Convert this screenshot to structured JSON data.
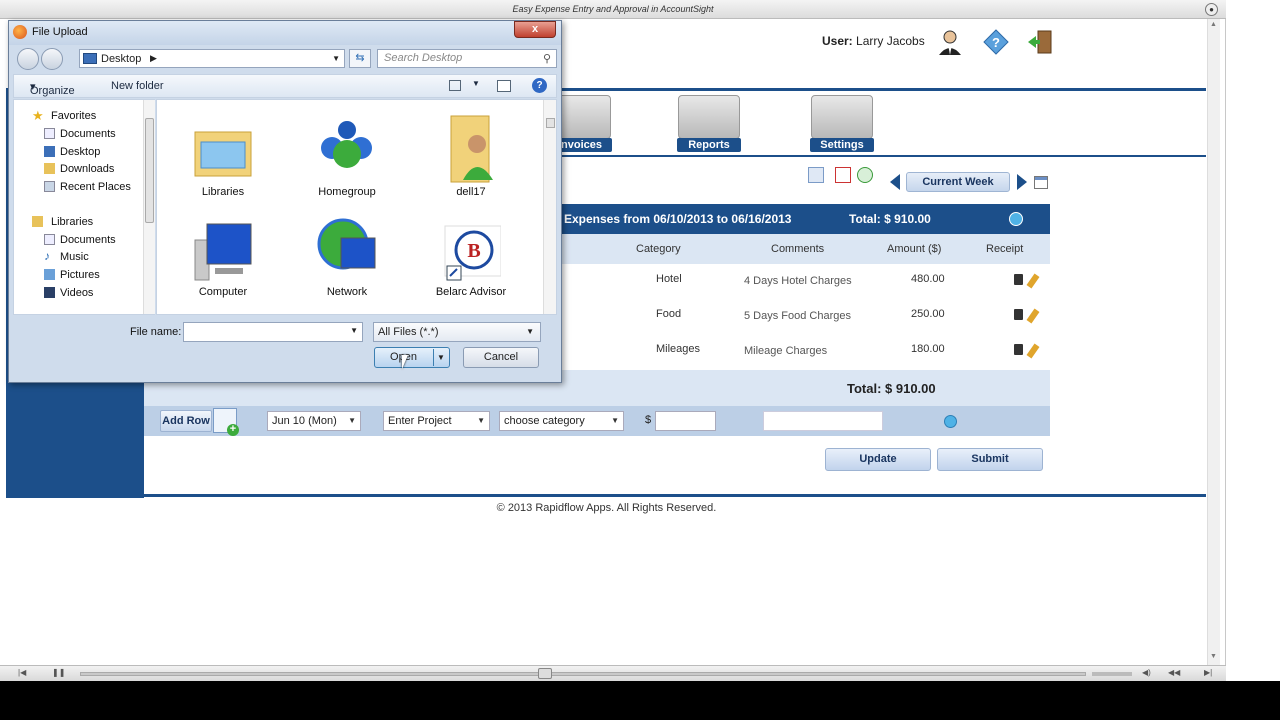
{
  "window": {
    "title": "Easy Expense Entry and Approval in AccountSight"
  },
  "header": {
    "user_label": "User:",
    "user_name": "Larry Jacobs"
  },
  "nav": {
    "tabs": [
      {
        "label": "Invoices"
      },
      {
        "label": "Reports"
      },
      {
        "label": "Settings"
      }
    ]
  },
  "week": {
    "current_label": "Current Week"
  },
  "expenses": {
    "range_text": "Expenses from  06/10/2013 to 06/16/2013",
    "total_header": "Total: $ 910.00",
    "columns": [
      "Category",
      "Comments",
      "Amount ($)",
      "Receipt"
    ],
    "rows": [
      {
        "category": "Hotel",
        "comment": "4 Days Hotel Charges",
        "amount": "480.00"
      },
      {
        "category": "Food",
        "comment": "5 Days Food Charges",
        "amount": "250.00"
      },
      {
        "category": "Mileages",
        "comment": "Mileage Charges",
        "amount": "180.00"
      }
    ],
    "total_footer": "Total: $ 910.00"
  },
  "add_row": {
    "button_label": "Add Row",
    "date": "Jun 10 (Mon)",
    "project": "Enter Project",
    "category": "choose category",
    "currency": "$"
  },
  "actions": {
    "update": "Update",
    "submit": "Submit"
  },
  "footer": {
    "copyright": "© 2013 Rapidflow Apps. All Rights Reserved."
  },
  "dialog": {
    "title": "File Upload",
    "close": "x",
    "address": "Desktop",
    "search_placeholder": "Search Desktop",
    "toolbar": {
      "organize": "Organize",
      "new_folder": "New folder"
    },
    "nav_groups": [
      {
        "label": "Favorites",
        "items": [
          "Documents",
          "Desktop",
          "Downloads",
          "Recent Places"
        ]
      },
      {
        "label": "Libraries",
        "items": [
          "Documents",
          "Music",
          "Pictures",
          "Videos"
        ]
      }
    ],
    "files": [
      "Libraries",
      "Homegroup",
      "dell17",
      "Computer",
      "Network",
      "Belarc Advisor"
    ],
    "file_name_label": "File name:",
    "file_name_value": "",
    "file_type": "All Files (*.*)",
    "open": "Open",
    "cancel": "Cancel"
  },
  "colors": {
    "brand_blue": "#1c4f8a",
    "light_blue": "#dbe6f3"
  }
}
